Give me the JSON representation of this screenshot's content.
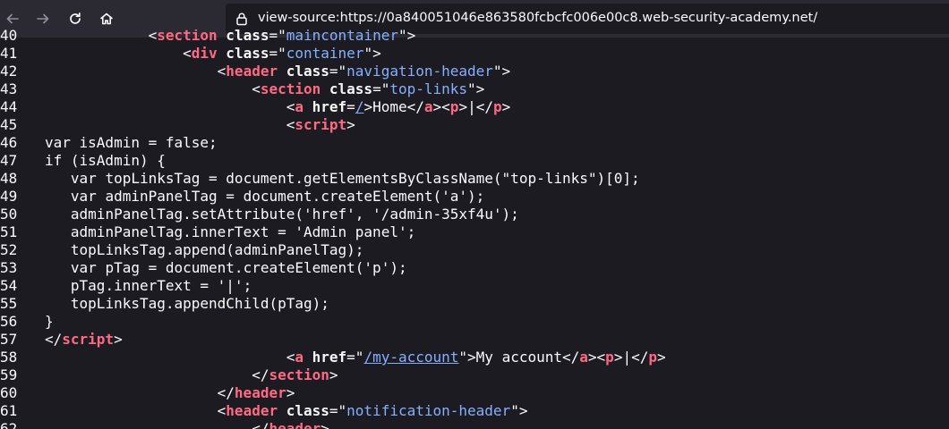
{
  "browser": {
    "url": "view-source:https://0a840051046e863580fcbcfc006e00c8.web-security-academy.net/"
  },
  "icons": {
    "back": "arrow-left-icon",
    "forward": "arrow-right-icon",
    "reload": "reload-icon",
    "home": "home-icon",
    "lock": "lock-icon"
  },
  "colors": {
    "background": "#1c1b22",
    "toolbar": "#2b2a33",
    "tagname": "#ff6a83",
    "attribute_value": "#86b0ff",
    "text": "#fbfbfe"
  },
  "source_lines": [
    {
      "n": "40",
      "indent": "            ",
      "parts": [
        {
          "t": "<",
          "c": "punct"
        },
        {
          "t": "section",
          "c": "tagname"
        },
        {
          "t": " class",
          "c": "attr"
        },
        {
          "t": "=\"",
          "c": "punct"
        },
        {
          "t": "maincontainer",
          "c": "val"
        },
        {
          "t": "\">",
          "c": "punct"
        }
      ]
    },
    {
      "n": "41",
      "indent": "                ",
      "parts": [
        {
          "t": "<",
          "c": "punct"
        },
        {
          "t": "div",
          "c": "tagname"
        },
        {
          "t": " class",
          "c": "attr"
        },
        {
          "t": "=\"",
          "c": "punct"
        },
        {
          "t": "container",
          "c": "val"
        },
        {
          "t": "\">",
          "c": "punct"
        }
      ]
    },
    {
      "n": "42",
      "indent": "                    ",
      "parts": [
        {
          "t": "<",
          "c": "punct"
        },
        {
          "t": "header",
          "c": "tagname"
        },
        {
          "t": " class",
          "c": "attr"
        },
        {
          "t": "=\"",
          "c": "punct"
        },
        {
          "t": "navigation-header",
          "c": "val"
        },
        {
          "t": "\">",
          "c": "punct"
        }
      ]
    },
    {
      "n": "43",
      "indent": "                        ",
      "parts": [
        {
          "t": "<",
          "c": "punct"
        },
        {
          "t": "section",
          "c": "tagname"
        },
        {
          "t": " class",
          "c": "attr"
        },
        {
          "t": "=\"",
          "c": "punct"
        },
        {
          "t": "top-links",
          "c": "val"
        },
        {
          "t": "\">",
          "c": "punct"
        }
      ]
    },
    {
      "n": "44",
      "indent": "                            ",
      "parts": [
        {
          "t": "<",
          "c": "punct"
        },
        {
          "t": "a",
          "c": "tagname"
        },
        {
          "t": " href",
          "c": "attr"
        },
        {
          "t": "=",
          "c": "punct"
        },
        {
          "t": "/",
          "c": "lnk"
        },
        {
          "t": ">Home</",
          "c": "punct"
        },
        {
          "t": "a",
          "c": "tagname"
        },
        {
          "t": "><",
          "c": "punct"
        },
        {
          "t": "p",
          "c": "tagname"
        },
        {
          "t": ">|</",
          "c": "punct"
        },
        {
          "t": "p",
          "c": "tagname"
        },
        {
          "t": ">",
          "c": "punct"
        }
      ]
    },
    {
      "n": "45",
      "indent": "                            ",
      "parts": [
        {
          "t": "<",
          "c": "punct"
        },
        {
          "t": "script",
          "c": "tagname"
        },
        {
          "t": ">",
          "c": "punct"
        }
      ]
    },
    {
      "n": "46",
      "indent": "",
      "parts": [
        {
          "t": "var isAdmin = false;",
          "c": "txt"
        }
      ]
    },
    {
      "n": "47",
      "indent": "",
      "parts": [
        {
          "t": "if (isAdmin) {",
          "c": "txt"
        }
      ]
    },
    {
      "n": "48",
      "indent": "   ",
      "parts": [
        {
          "t": "var topLinksTag = document.getElementsByClassName(\"top-links\")[0];",
          "c": "txt"
        }
      ]
    },
    {
      "n": "49",
      "indent": "   ",
      "parts": [
        {
          "t": "var adminPanelTag = document.createElement('a');",
          "c": "txt"
        }
      ]
    },
    {
      "n": "50",
      "indent": "   ",
      "parts": [
        {
          "t": "adminPanelTag.setAttribute('href', '/admin-35xf4u');",
          "c": "txt"
        }
      ]
    },
    {
      "n": "51",
      "indent": "   ",
      "parts": [
        {
          "t": "adminPanelTag.innerText = 'Admin panel';",
          "c": "txt"
        }
      ]
    },
    {
      "n": "52",
      "indent": "   ",
      "parts": [
        {
          "t": "topLinksTag.append(adminPanelTag);",
          "c": "txt"
        }
      ]
    },
    {
      "n": "53",
      "indent": "   ",
      "parts": [
        {
          "t": "var pTag = document.createElement('p');",
          "c": "txt"
        }
      ]
    },
    {
      "n": "54",
      "indent": "   ",
      "parts": [
        {
          "t": "pTag.innerText = '|';",
          "c": "txt"
        }
      ]
    },
    {
      "n": "55",
      "indent": "   ",
      "parts": [
        {
          "t": "topLinksTag.appendChild(pTag);",
          "c": "txt"
        }
      ]
    },
    {
      "n": "56",
      "indent": "",
      "parts": [
        {
          "t": "}",
          "c": "txt"
        }
      ]
    },
    {
      "n": "57",
      "indent": "",
      "parts": [
        {
          "t": "</",
          "c": "punct"
        },
        {
          "t": "script",
          "c": "tagname"
        },
        {
          "t": ">",
          "c": "punct"
        }
      ]
    },
    {
      "n": "58",
      "indent": "                            ",
      "parts": [
        {
          "t": "<",
          "c": "punct"
        },
        {
          "t": "a",
          "c": "tagname"
        },
        {
          "t": " href",
          "c": "attr"
        },
        {
          "t": "=\"",
          "c": "punct"
        },
        {
          "t": "/my-account",
          "c": "lnk"
        },
        {
          "t": "\">My account</",
          "c": "punct"
        },
        {
          "t": "a",
          "c": "tagname"
        },
        {
          "t": "><",
          "c": "punct"
        },
        {
          "t": "p",
          "c": "tagname"
        },
        {
          "t": ">|</",
          "c": "punct"
        },
        {
          "t": "p",
          "c": "tagname"
        },
        {
          "t": ">",
          "c": "punct"
        }
      ]
    },
    {
      "n": "59",
      "indent": "                        ",
      "parts": [
        {
          "t": "</",
          "c": "punct"
        },
        {
          "t": "section",
          "c": "tagname"
        },
        {
          "t": ">",
          "c": "punct"
        }
      ]
    },
    {
      "n": "60",
      "indent": "                    ",
      "parts": [
        {
          "t": "</",
          "c": "punct"
        },
        {
          "t": "header",
          "c": "tagname"
        },
        {
          "t": ">",
          "c": "punct"
        }
      ]
    },
    {
      "n": "61",
      "indent": "                    ",
      "parts": [
        {
          "t": "<",
          "c": "punct"
        },
        {
          "t": "header",
          "c": "tagname"
        },
        {
          "t": " class",
          "c": "attr"
        },
        {
          "t": "=\"",
          "c": "punct"
        },
        {
          "t": "notification-header",
          "c": "val"
        },
        {
          "t": "\">",
          "c": "punct"
        }
      ]
    },
    {
      "n": "62",
      "indent": "                        ",
      "parts": [
        {
          "t": "</",
          "c": "punct"
        },
        {
          "t": "header",
          "c": "tagname"
        },
        {
          "t": ">",
          "c": "punct"
        }
      ]
    }
  ]
}
